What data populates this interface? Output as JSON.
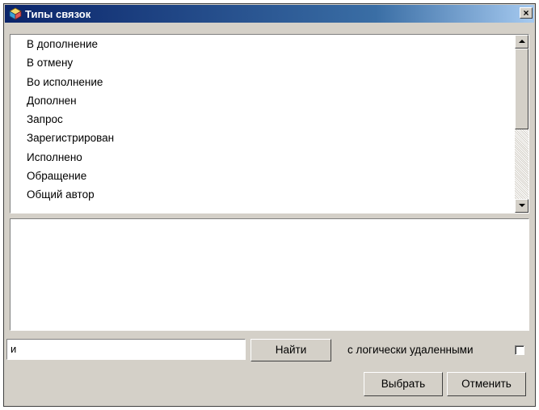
{
  "window": {
    "title": "Типы связок",
    "close_label": "×"
  },
  "list": {
    "items": [
      "В дополнение",
      "В отмену",
      "Во исполнение",
      "Дополнен",
      "Запрос",
      "Зарегистрирован",
      "Исполнено",
      "Обращение",
      "Общий автор"
    ]
  },
  "search": {
    "value": "и"
  },
  "buttons": {
    "find": "Найти",
    "select": "Выбрать",
    "cancel": "Отменить"
  },
  "checkbox": {
    "label": "с логически удаленными",
    "checked": false
  },
  "colors": {
    "titlebar_start": "#0a246a",
    "titlebar_end": "#a6caf0",
    "dialog_bg": "#d4d0c8"
  }
}
